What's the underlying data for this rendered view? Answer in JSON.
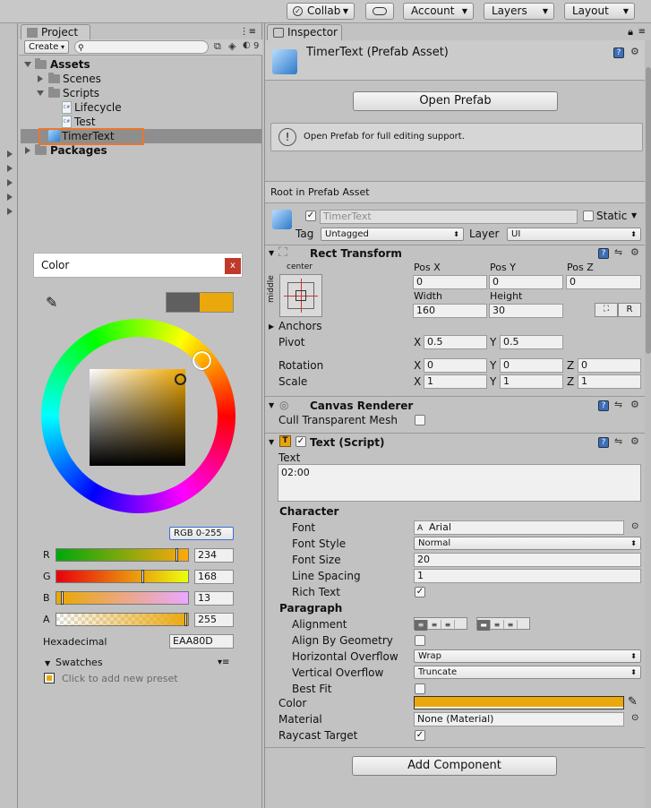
{
  "toolbar": {
    "collab": "Collab",
    "account": "Account",
    "layers": "Layers",
    "layout": "Layout"
  },
  "project": {
    "tab_label": "Project",
    "create_label": "Create",
    "count": "9",
    "tree": [
      {
        "label": "Assets",
        "level": 0,
        "type": "folder",
        "expanded": true,
        "bold": true
      },
      {
        "label": "Scenes",
        "level": 1,
        "type": "folder",
        "expanded": false
      },
      {
        "label": "Scripts",
        "level": 1,
        "type": "folder",
        "expanded": true
      },
      {
        "label": "Lifecycle",
        "level": 2,
        "type": "script"
      },
      {
        "label": "Test",
        "level": 2,
        "type": "script"
      },
      {
        "label": "TimerText",
        "level": 1,
        "type": "prefab",
        "selected": true
      },
      {
        "label": "Packages",
        "level": 0,
        "type": "folder",
        "expanded": false,
        "bold": true
      }
    ]
  },
  "color_picker": {
    "title": "Color",
    "close": "x",
    "mode": "RGB 0-255",
    "channels": [
      {
        "label": "R",
        "value": "234",
        "fraction": 0.918
      },
      {
        "label": "G",
        "value": "168",
        "fraction": 0.659
      },
      {
        "label": "B",
        "value": "13",
        "fraction": 0.051
      },
      {
        "label": "A",
        "value": "255",
        "fraction": 1.0
      }
    ],
    "hex_label": "Hexadecimal",
    "hex_value": "EAA80D",
    "swatches_label": "Swatches",
    "add_preset": "Click to add new preset",
    "current_color": "#EAA80D",
    "previous_color": "#5f5f5f"
  },
  "inspector": {
    "tab_label": "Inspector",
    "asset_title": "TimerText (Prefab Asset)",
    "open_prefab": "Open Prefab",
    "info_text": "Open Prefab for full editing support.",
    "root_label": "Root in Prefab Asset",
    "object_name": "TimerText",
    "static_label": "Static",
    "tag_label": "Tag",
    "tag_value": "Untagged",
    "layer_label": "Layer",
    "layer_value": "UI",
    "rect_transform": {
      "title": "Rect Transform",
      "anchor_h": "center",
      "anchor_v": "middle",
      "pos_x_label": "Pos X",
      "pos_x": "0",
      "pos_y_label": "Pos Y",
      "pos_y": "0",
      "pos_z_label": "Pos Z",
      "pos_z": "0",
      "width_label": "Width",
      "width": "160",
      "height_label": "Height",
      "height": "30",
      "raw_label": "R",
      "anchors_label": "Anchors",
      "pivot_label": "Pivot",
      "pivot_x": "0.5",
      "pivot_y": "0.5",
      "rotation_label": "Rotation",
      "rot_x": "0",
      "rot_y": "0",
      "rot_z": "0",
      "scale_label": "Scale",
      "scale_x": "1",
      "scale_y": "1",
      "scale_z": "1",
      "x": "X",
      "y": "Y",
      "z": "Z"
    },
    "canvas_renderer": {
      "title": "Canvas Renderer",
      "cull_label": "Cull Transparent Mesh"
    },
    "text_script": {
      "title": "Text (Script)",
      "text_label": "Text",
      "text_value": "02:00",
      "character_label": "Character",
      "font_label": "Font",
      "font_value": "Arial",
      "font_style_label": "Font Style",
      "font_style_value": "Normal",
      "font_size_label": "Font Size",
      "font_size_value": "20",
      "line_spacing_label": "Line Spacing",
      "line_spacing_value": "1",
      "rich_text_label": "Rich Text",
      "paragraph_label": "Paragraph",
      "alignment_label": "Alignment",
      "align_geometry_label": "Align By Geometry",
      "h_overflow_label": "Horizontal Overflow",
      "h_overflow_value": "Wrap",
      "v_overflow_label": "Vertical Overflow",
      "v_overflow_value": "Truncate",
      "best_fit_label": "Best Fit",
      "color_label": "Color",
      "material_label": "Material",
      "material_value": "None (Material)",
      "raycast_label": "Raycast Target"
    },
    "add_component": "Add Component"
  }
}
